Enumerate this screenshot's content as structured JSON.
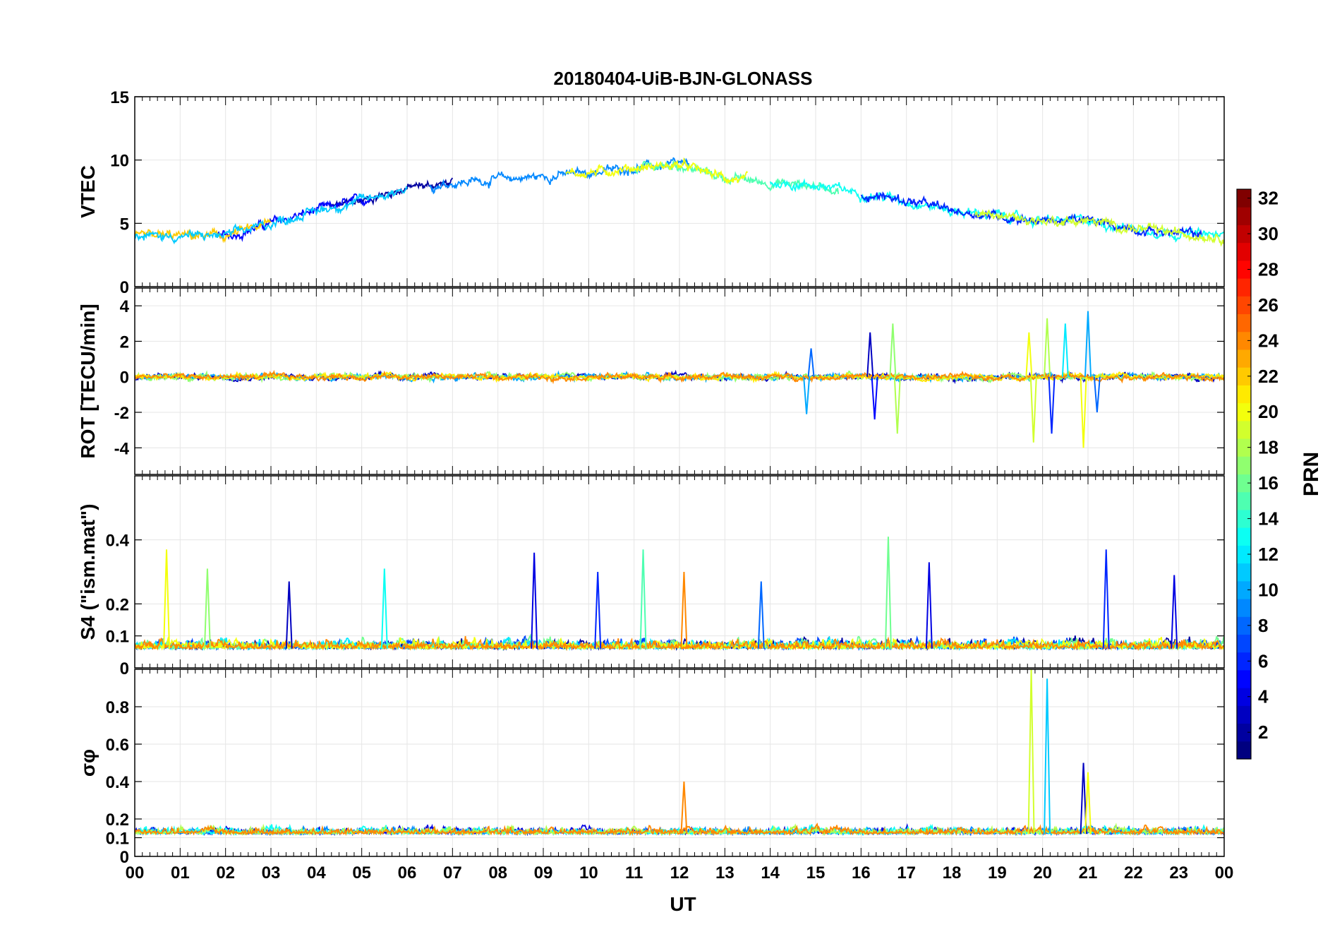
{
  "chart_data": {
    "type": "line",
    "title": "20180404-UiB-BJN-GLONASS",
    "xlabel": "UT",
    "x_ticks": [
      "00",
      "01",
      "02",
      "03",
      "04",
      "05",
      "06",
      "07",
      "08",
      "09",
      "10",
      "11",
      "12",
      "13",
      "14",
      "15",
      "16",
      "17",
      "18",
      "19",
      "20",
      "21",
      "22",
      "23",
      "00"
    ],
    "xlim": [
      0,
      24
    ],
    "grid": true,
    "panels": [
      {
        "id": "vtec",
        "ylabel": "VTEC",
        "ylim": [
          0,
          15
        ],
        "yticks": [
          0,
          5,
          10,
          15
        ],
        "tick_labels": [
          "0",
          "5",
          "10",
          "15"
        ],
        "trend": [
          [
            0,
            4
          ],
          [
            1,
            4
          ],
          [
            2,
            4
          ],
          [
            3,
            5
          ],
          [
            4,
            6
          ],
          [
            5,
            6.8
          ],
          [
            6,
            7.8
          ],
          [
            7,
            8.2
          ],
          [
            8,
            8.5
          ],
          [
            9,
            8.7
          ],
          [
            10,
            9
          ],
          [
            11,
            9.4
          ],
          [
            12,
            9.6
          ],
          [
            13,
            8.6
          ],
          [
            14,
            8.2
          ],
          [
            15,
            8
          ],
          [
            16,
            7.4
          ],
          [
            17,
            6.8
          ],
          [
            18,
            6
          ],
          [
            19,
            5.6
          ],
          [
            20,
            5.2
          ],
          [
            21,
            5.2
          ],
          [
            22,
            4.6
          ],
          [
            23,
            4.2
          ],
          [
            24,
            4
          ]
        ],
        "seed_noise": 0.35,
        "spikes": [],
        "lines": [
          {
            "prn": 2,
            "x0": 4.3,
            "x1": 7.0
          },
          {
            "prn": 5,
            "x0": 1.8,
            "x1": 5.2
          },
          {
            "prn": 9,
            "x0": 6.5,
            "x1": 12.2
          },
          {
            "prn": 15,
            "x0": 11.0,
            "x1": 15.5
          },
          {
            "prn": 20,
            "x0": 9.5,
            "x1": 13.5
          },
          {
            "prn": 22,
            "x0": 0.0,
            "x1": 3.0
          },
          {
            "prn": 13,
            "x0": 14.0,
            "x1": 24.0
          },
          {
            "prn": 6,
            "x0": 16.0,
            "x1": 23.5
          },
          {
            "prn": 19,
            "x0": 18.5,
            "x1": 24.0
          },
          {
            "prn": 11,
            "x0": 0.0,
            "x1": 6.0
          }
        ]
      },
      {
        "id": "rot",
        "ylabel": "ROT [TECU/min]",
        "ylim": [
          -5.5,
          5
        ],
        "yticks": [
          -4,
          -2,
          0,
          2,
          4
        ],
        "tick_labels": [
          "-4",
          "-2",
          "0",
          "2",
          "4"
        ],
        "trend": [
          [
            0,
            0
          ],
          [
            24,
            0
          ]
        ],
        "seed_noise": 0.15,
        "spikes": [
          {
            "x": 14.8,
            "value": -2.1,
            "prn": 10
          },
          {
            "x": 14.9,
            "value": 1.6,
            "prn": 8
          },
          {
            "x": 16.2,
            "value": 2.5,
            "prn": 3
          },
          {
            "x": 16.3,
            "value": -2.4,
            "prn": 5
          },
          {
            "x": 16.7,
            "value": 3.0,
            "prn": 17
          },
          {
            "x": 16.8,
            "value": -3.2,
            "prn": 18
          },
          {
            "x": 19.7,
            "value": 2.5,
            "prn": 20
          },
          {
            "x": 19.8,
            "value": -3.7,
            "prn": 19
          },
          {
            "x": 20.1,
            "value": 3.3,
            "prn": 18
          },
          {
            "x": 20.2,
            "value": -3.2,
            "prn": 6
          },
          {
            "x": 20.5,
            "value": 3.0,
            "prn": 12
          },
          {
            "x": 20.9,
            "value": -4.0,
            "prn": 20
          },
          {
            "x": 21.0,
            "value": 3.7,
            "prn": 10
          },
          {
            "x": 21.2,
            "value": -2.0,
            "prn": 8
          }
        ],
        "lines": [
          {
            "prn": 3,
            "x0": 0.0,
            "x1": 24.0
          },
          {
            "prn": 10,
            "x0": 0.0,
            "x1": 24.0
          },
          {
            "prn": 17,
            "x0": 0.0,
            "x1": 24.0
          },
          {
            "prn": 21,
            "x0": 0.0,
            "x1": 24.0
          },
          {
            "prn": 24,
            "x0": 0.0,
            "x1": 24.0
          }
        ]
      },
      {
        "id": "s4",
        "ylabel": "S4 (\"ism.mat\")",
        "ylim": [
          0,
          0.6
        ],
        "yticks": [
          0,
          0.1,
          0.2,
          0.4
        ],
        "tick_labels": [
          "0",
          "0.1",
          "0.2",
          "0.4"
        ],
        "trend": [
          [
            0,
            0.06
          ],
          [
            24,
            0.06
          ]
        ],
        "seed_noise": 0.02,
        "spikes": [
          {
            "x": 0.7,
            "value": 0.37,
            "prn": 20
          },
          {
            "x": 1.6,
            "value": 0.31,
            "prn": 17
          },
          {
            "x": 3.4,
            "value": 0.27,
            "prn": 3
          },
          {
            "x": 5.5,
            "value": 0.31,
            "prn": 13
          },
          {
            "x": 8.8,
            "value": 0.36,
            "prn": 4
          },
          {
            "x": 10.2,
            "value": 0.3,
            "prn": 6
          },
          {
            "x": 11.2,
            "value": 0.37,
            "prn": 15
          },
          {
            "x": 12.1,
            "value": 0.3,
            "prn": 24
          },
          {
            "x": 13.8,
            "value": 0.27,
            "prn": 8
          },
          {
            "x": 16.6,
            "value": 0.41,
            "prn": 16
          },
          {
            "x": 17.5,
            "value": 0.33,
            "prn": 4
          },
          {
            "x": 21.4,
            "value": 0.37,
            "prn": 6
          },
          {
            "x": 22.9,
            "value": 0.29,
            "prn": 4
          }
        ],
        "lines": [
          {
            "prn": 2,
            "x0": 0.0,
            "x1": 24.0
          },
          {
            "prn": 7,
            "x0": 0.0,
            "x1": 24.0
          },
          {
            "prn": 12,
            "x0": 0.0,
            "x1": 24.0
          },
          {
            "prn": 16,
            "x0": 0.0,
            "x1": 24.0
          },
          {
            "prn": 20,
            "x0": 0.0,
            "x1": 24.0
          },
          {
            "prn": 24,
            "x0": 0.0,
            "x1": 24.0
          }
        ]
      },
      {
        "id": "sigma",
        "ylabel": "σφ",
        "ylim": [
          0,
          1.0
        ],
        "yticks": [
          0,
          0.1,
          0.2,
          0.4,
          0.6,
          0.8
        ],
        "tick_labels": [
          "0",
          "0.1",
          "0.2",
          "0.4",
          "0.6",
          "0.8"
        ],
        "trend": [
          [
            0,
            0.12
          ],
          [
            24,
            0.12
          ]
        ],
        "seed_noise": 0.025,
        "spikes": [
          {
            "x": 19.75,
            "value": 1.0,
            "prn": 19
          },
          {
            "x": 20.1,
            "value": 0.95,
            "prn": 11
          },
          {
            "x": 20.9,
            "value": 0.5,
            "prn": 3
          },
          {
            "x": 21.0,
            "value": 0.45,
            "prn": 20
          },
          {
            "x": 12.1,
            "value": 0.4,
            "prn": 24
          }
        ],
        "lines": [
          {
            "prn": 4,
            "x0": 0.0,
            "x1": 24.0
          },
          {
            "prn": 9,
            "x0": 0.0,
            "x1": 24.0
          },
          {
            "prn": 13,
            "x0": 0.0,
            "x1": 24.0
          },
          {
            "prn": 18,
            "x0": 0.0,
            "x1": 24.0
          },
          {
            "prn": 24,
            "x0": 0.0,
            "x1": 24.0
          }
        ]
      }
    ],
    "colorbar": {
      "label": "PRN",
      "range": [
        1,
        32
      ],
      "ticks": [
        "2",
        "4",
        "6",
        "8",
        "10",
        "12",
        "14",
        "16",
        "18",
        "20",
        "22",
        "24",
        "26",
        "28",
        "30",
        "32"
      ],
      "colormap": "jet",
      "placement": "right"
    }
  }
}
